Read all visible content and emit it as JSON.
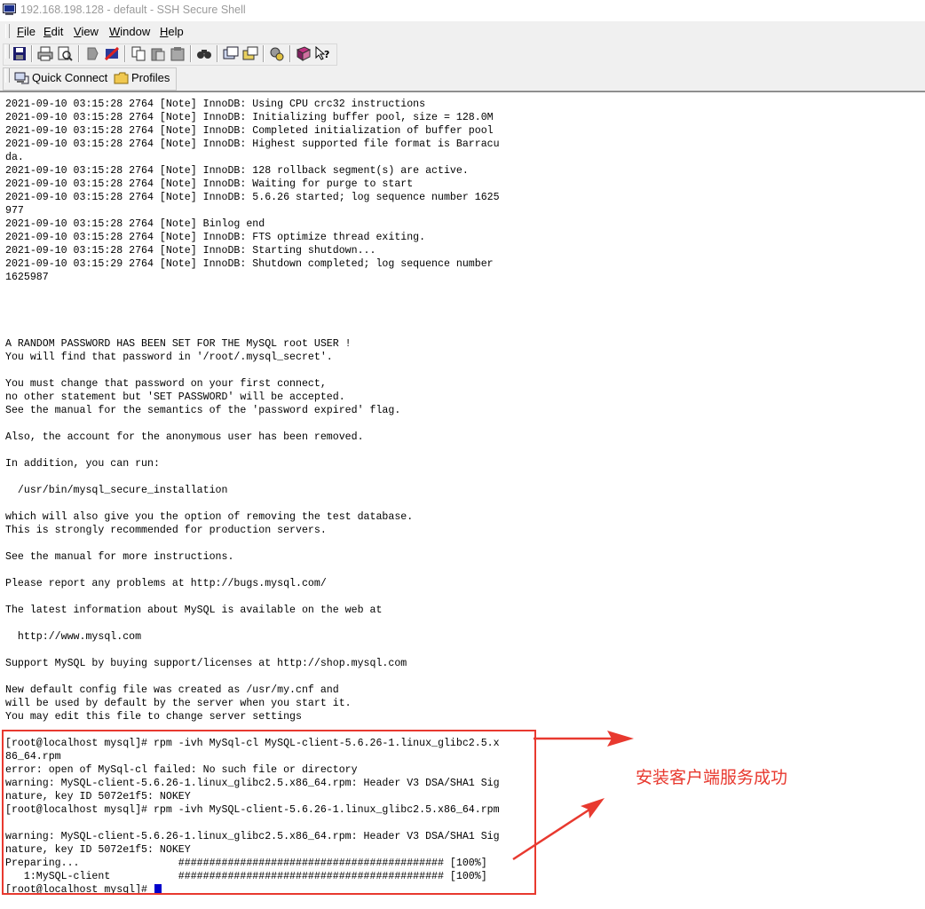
{
  "window": {
    "title": "192.168.198.128 - default - SSH Secure Shell"
  },
  "menu": [
    {
      "u": "F",
      "rest": "ile"
    },
    {
      "u": "E",
      "rest": "dit"
    },
    {
      "u": "V",
      "rest": "iew"
    },
    {
      "u": "W",
      "rest": "indow"
    },
    {
      "u": "H",
      "rest": "elp"
    }
  ],
  "toolbar_icons": [
    "save-icon",
    "print-icon",
    "print-preview-icon",
    "disconnect-icon",
    "new-session-icon",
    "copy-icon",
    "paste-icon",
    "paste-special-icon",
    "find-icon",
    "file-transfer-icon",
    "new-terminal-icon",
    "settings-icon",
    "help-book-icon",
    "context-help-icon"
  ],
  "quickbar": {
    "quick_connect": "Quick Connect",
    "profiles": "Profiles"
  },
  "terminal_lines": [
    "2021-09-10 03:15:28 2764 [Note] InnoDB: Using CPU crc32 instructions",
    "2021-09-10 03:15:28 2764 [Note] InnoDB: Initializing buffer pool, size = 128.0M",
    "2021-09-10 03:15:28 2764 [Note] InnoDB: Completed initialization of buffer pool",
    "2021-09-10 03:15:28 2764 [Note] InnoDB: Highest supported file format is Barracu",
    "da.",
    "2021-09-10 03:15:28 2764 [Note] InnoDB: 128 rollback segment(s) are active.",
    "2021-09-10 03:15:28 2764 [Note] InnoDB: Waiting for purge to start",
    "2021-09-10 03:15:28 2764 [Note] InnoDB: 5.6.26 started; log sequence number 1625",
    "977",
    "2021-09-10 03:15:28 2764 [Note] Binlog end",
    "2021-09-10 03:15:28 2764 [Note] InnoDB: FTS optimize thread exiting.",
    "2021-09-10 03:15:28 2764 [Note] InnoDB: Starting shutdown...",
    "2021-09-10 03:15:29 2764 [Note] InnoDB: Shutdown completed; log sequence number",
    "1625987",
    "",
    "",
    "",
    "",
    "A RANDOM PASSWORD HAS BEEN SET FOR THE MySQL root USER !",
    "You will find that password in '/root/.mysql_secret'.",
    "",
    "You must change that password on your first connect,",
    "no other statement but 'SET PASSWORD' will be accepted.",
    "See the manual for the semantics of the 'password expired' flag.",
    "",
    "Also, the account for the anonymous user has been removed.",
    "",
    "In addition, you can run:",
    "",
    "  /usr/bin/mysql_secure_installation",
    "",
    "which will also give you the option of removing the test database.",
    "This is strongly recommended for production servers.",
    "",
    "See the manual for more instructions.",
    "",
    "Please report any problems at http://bugs.mysql.com/",
    "",
    "The latest information about MySQL is available on the web at",
    "",
    "  http://www.mysql.com",
    "",
    "Support MySQL by buying support/licenses at http://shop.mysql.com",
    "",
    "New default config file was created as /usr/my.cnf and",
    "will be used by default by the server when you start it.",
    "You may edit this file to change server settings",
    "",
    "[root@localhost mysql]# rpm -ivh MySql-cl MySQL-client-5.6.26-1.linux_glibc2.5.x",
    "86_64.rpm",
    "error: open of MySql-cl failed: No such file or directory",
    "warning: MySQL-client-5.6.26-1.linux_glibc2.5.x86_64.rpm: Header V3 DSA/SHA1 Sig",
    "nature, key ID 5072e1f5: NOKEY",
    "[root@localhost mysql]# rpm -ivh MySQL-client-5.6.26-1.linux_glibc2.5.x86_64.rpm",
    "",
    "warning: MySQL-client-5.6.26-1.linux_glibc2.5.x86_64.rpm: Header V3 DSA/SHA1 Sig",
    "nature, key ID 5072e1f5: NOKEY",
    "Preparing...                ########################################### [100%]",
    "   1:MySQL-client           ########################################### [100%]",
    "[root@localhost mysql]# "
  ],
  "annotation": {
    "text": "安装客户端服务成功",
    "color": "#e8392f"
  },
  "colors": {
    "cursor": "#0000cc",
    "highlight": "#e8392f"
  }
}
